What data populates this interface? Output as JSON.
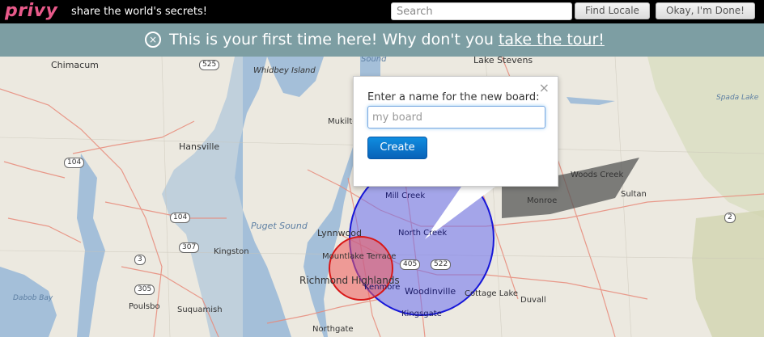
{
  "topbar": {
    "logo": "privy",
    "tagline": "share the world's secrets!",
    "search_placeholder": "Search",
    "find_label": "Find Locale",
    "done_label": "Okay, I'm Done!"
  },
  "banner": {
    "close_glyph": "×",
    "text": "This is your first time here! Why don't you ",
    "link": "take the tour!"
  },
  "map": {
    "places": [
      "Chimacum",
      "Whidbey Island",
      "Lake Stevens",
      "Hansville",
      "Mukilteo",
      "Mill Creek",
      "Woods Creek",
      "Monroe",
      "Sultan",
      "Lynnwood",
      "North Creek",
      "Puget Sound",
      "Kingston",
      "Mountlake Terrace",
      "Richmond Highlands",
      "Kenmore",
      "Woodinville",
      "Cottage Lake",
      "Duvall",
      "Poulsbo",
      "Suquamish",
      "Kingsgate",
      "Northgate",
      "Dabob Bay",
      "Spada Lake",
      "Sound"
    ],
    "highways": [
      "525",
      "104",
      "104",
      "307",
      "3",
      "305",
      "405",
      "522",
      "2"
    ]
  },
  "popover": {
    "close_glyph": "×",
    "label": "Enter a name for the new board:",
    "input_placeholder": "my board",
    "create_label": "Create"
  }
}
